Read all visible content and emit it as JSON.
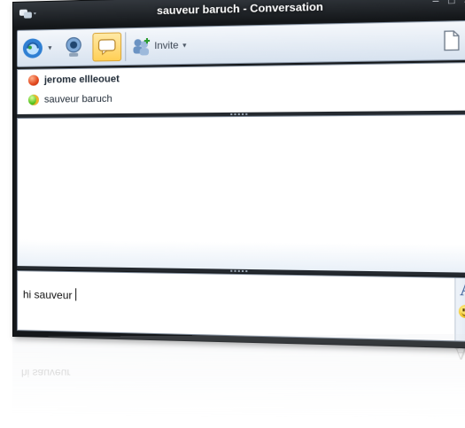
{
  "window": {
    "title": "sauveur baruch - Conversation",
    "buttons": {
      "minimize": "–",
      "maximize": "□",
      "close": "✕"
    }
  },
  "toolbar": {
    "invite_label": "Invite",
    "icons": [
      "msn-logo-icon",
      "webcam-icon",
      "chat-bubble-icon",
      "invite-contacts-icon",
      "document-icon"
    ]
  },
  "contacts": [
    {
      "name": "jerome ellleouet",
      "status": "busy",
      "status_color": "#e2461b"
    },
    {
      "name": "sauveur baruch",
      "status": "online",
      "status_color": "#55c21d"
    }
  ],
  "compose": {
    "text": "hi sauveur",
    "font_button": "A"
  },
  "colors": {
    "frame": "#14171a",
    "toolbar": "#d7e2ef",
    "accent_chat": "#ffcf55"
  }
}
